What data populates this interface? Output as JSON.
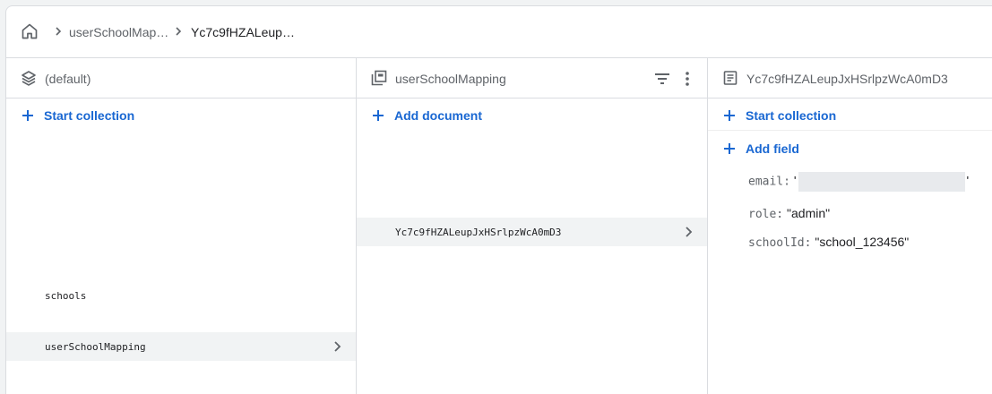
{
  "breadcrumb": {
    "items": [
      "userSchoolMap…",
      "Yc7c9fHZALeup…"
    ]
  },
  "root_panel": {
    "title": "(default)",
    "action_label": "Start collection",
    "collections": [
      "schools",
      "userSchoolMapping"
    ]
  },
  "collection_panel": {
    "title": "userSchoolMapping",
    "action_label": "Add document",
    "documents": [
      "Yc7c9fHZALeupJxHSrlpzWcA0mD3"
    ]
  },
  "document_panel": {
    "title": "Yc7c9fHZALeupJxHSrlpzWcA0mD3",
    "start_collection_label": "Start collection",
    "add_field_label": "Add field",
    "fields": [
      {
        "key": "email:",
        "value_open": "'",
        "value_close": "'"
      },
      {
        "key": "role:",
        "value": "\"admin\""
      },
      {
        "key": "schoolId:",
        "value": "\"school_123456\""
      }
    ]
  },
  "colors": {
    "accent": "#1967d2",
    "selected_row": "#f1f3f4",
    "border": "#dadce0"
  },
  "icons": {
    "home": "home-icon",
    "separator": "chevron-right-icon",
    "database": "database-icon",
    "collection": "collection-icon",
    "document": "document-icon",
    "filter": "filter-icon",
    "more": "more-vert-icon"
  }
}
